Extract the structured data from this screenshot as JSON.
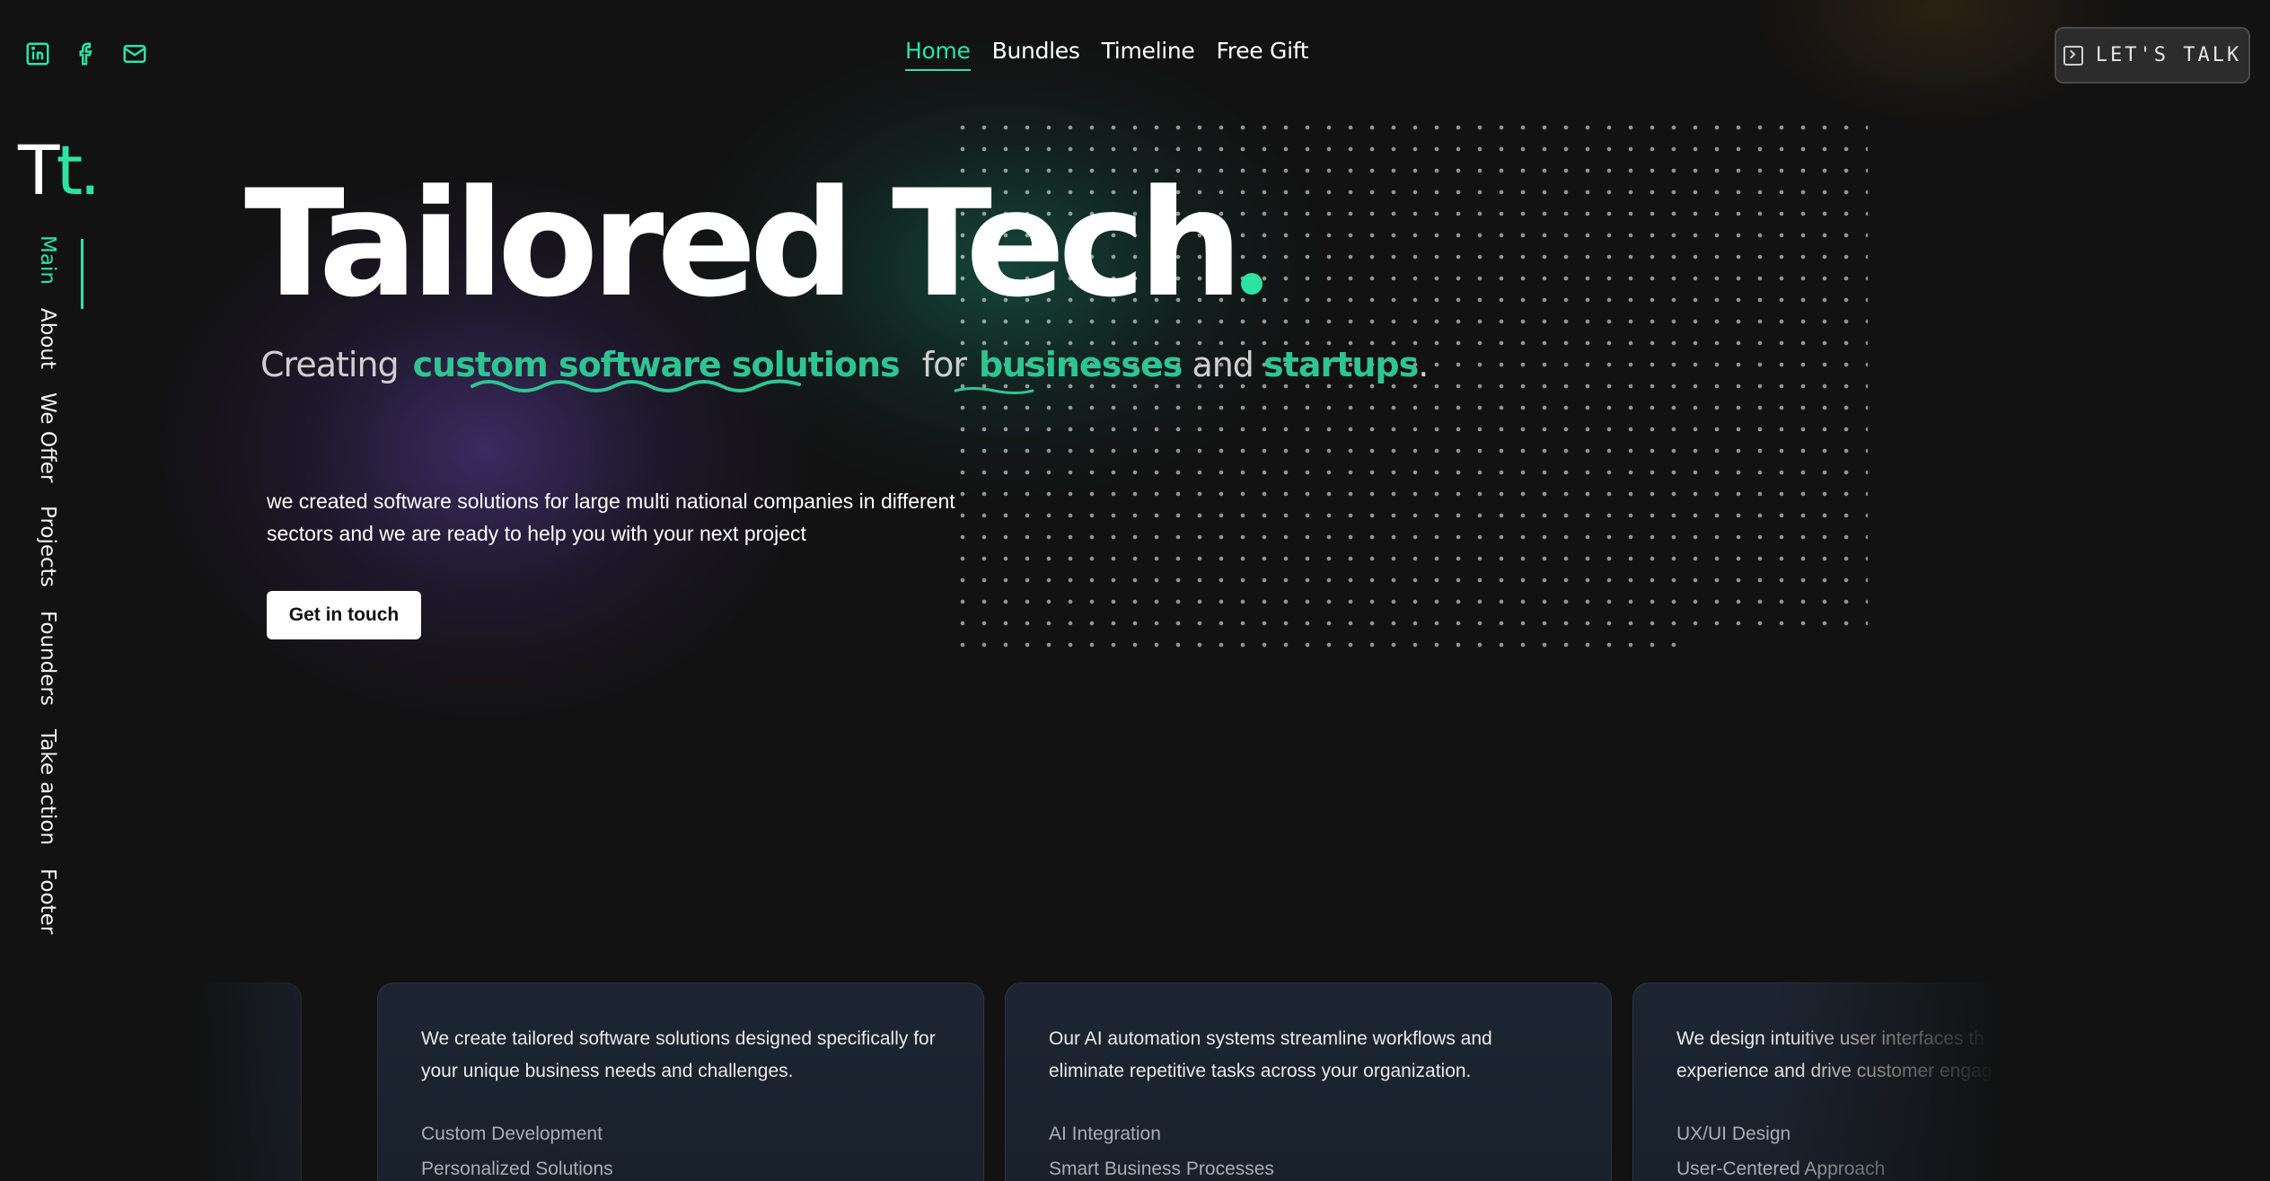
{
  "social": {
    "icons": [
      "linkedin-icon",
      "facebook-icon",
      "mail-icon"
    ],
    "accent": "#2de3a4"
  },
  "topnav": {
    "items": [
      {
        "label": "Home",
        "active": true
      },
      {
        "label": "Bundles",
        "active": false
      },
      {
        "label": "Timeline",
        "active": false
      },
      {
        "label": "Free Gift",
        "active": false
      }
    ]
  },
  "cta_top": {
    "label": "LET'S TALK",
    "icon": "terminal-icon"
  },
  "logo": {
    "t1": "T",
    "t2": "t",
    "dot": "."
  },
  "sidenav": {
    "items": [
      {
        "label": "Main",
        "active": true
      },
      {
        "label": "About",
        "active": false
      },
      {
        "label": "We Offer",
        "active": false
      },
      {
        "label": "Projects",
        "active": false
      },
      {
        "label": "Founders",
        "active": false
      },
      {
        "label": "Take action",
        "active": false
      },
      {
        "label": "Footer",
        "active": false
      }
    ]
  },
  "hero": {
    "title": "Tailored Tech",
    "tagline": {
      "w1": "Creating",
      "w2": "custom software solutions",
      "w3": "for",
      "w4": "businesses",
      "w5": "and",
      "w6": "startups",
      "w7": "."
    },
    "description": "we created software solutions for large multi national companies in different sectors and we are ready to help you with your next project",
    "button": "Get in touch"
  },
  "cards": [
    {
      "description": "We create tailored software solutions designed specifically for your unique business needs and challenges.",
      "items": [
        "Custom Development",
        "Personalized Solutions"
      ]
    },
    {
      "description": "Our AI automation systems streamline workflows and eliminate repetitive tasks across your organization.",
      "items": [
        "AI Integration",
        "Smart Business Processes"
      ]
    },
    {
      "description_line1": "We design intuitive user interfaces th",
      "description_line2": "experience and drive customer engag",
      "items": [
        "UX/UI Design",
        "User-Centered Approach"
      ]
    }
  ],
  "colors": {
    "background": "#121212",
    "accent": "#2de3a4",
    "tagline_accent": "#2fc491"
  }
}
